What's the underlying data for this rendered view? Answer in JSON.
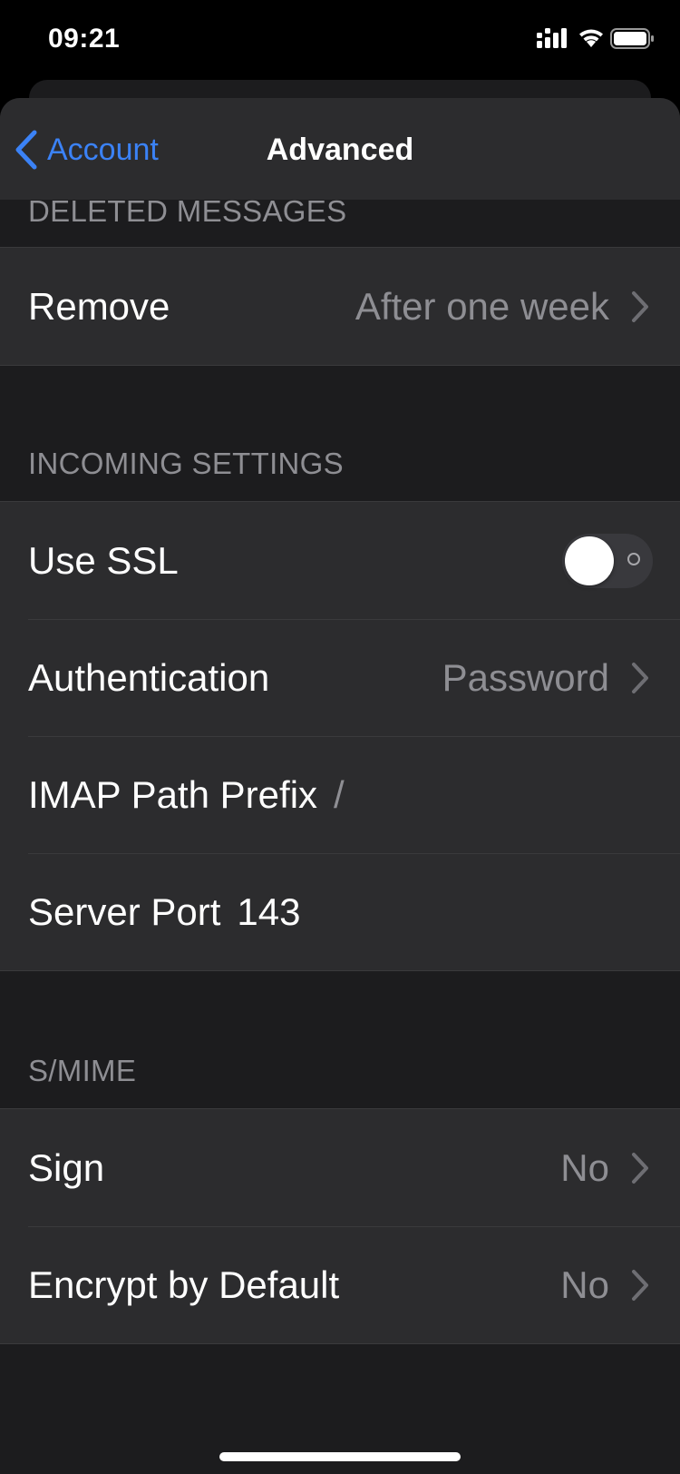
{
  "status_bar": {
    "time": "09:21"
  },
  "nav": {
    "back_label": "Account",
    "title": "Advanced"
  },
  "sections": {
    "deleted_messages": {
      "header": "DELETED MESSAGES",
      "remove": {
        "label": "Remove",
        "value": "After one week"
      }
    },
    "incoming": {
      "header": "INCOMING SETTINGS",
      "use_ssl": {
        "label": "Use SSL",
        "enabled": false
      },
      "authentication": {
        "label": "Authentication",
        "value": "Password"
      },
      "imap_path_prefix": {
        "label": "IMAP Path Prefix",
        "value": "/"
      },
      "server_port": {
        "label": "Server Port",
        "value": "143"
      }
    },
    "smime": {
      "header": "S/MIME",
      "sign": {
        "label": "Sign",
        "value": "No"
      },
      "encrypt_by_default": {
        "label": "Encrypt by Default",
        "value": "No"
      }
    }
  },
  "colors": {
    "accent": "#3b82f6",
    "background": "#1c1c1e",
    "cell": "#2c2c2e",
    "secondary_text": "#8e8e93"
  }
}
